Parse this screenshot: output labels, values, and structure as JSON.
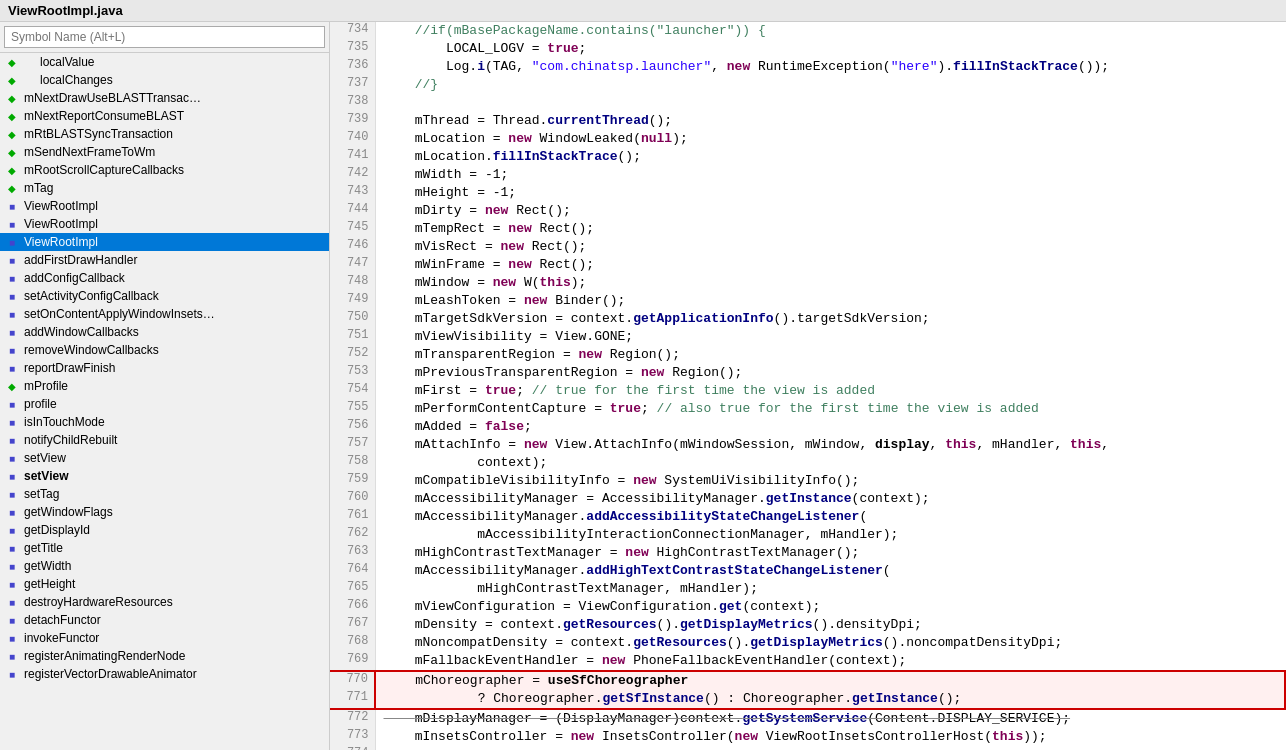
{
  "title": "ViewRootImpl.java",
  "search": {
    "placeholder": "Symbol Name (Alt+L)"
  },
  "sidebar": {
    "items": [
      {
        "icon": "green-diamond",
        "label": "localValue",
        "indent": 1
      },
      {
        "icon": "green-diamond",
        "label": "localChanges",
        "indent": 1
      },
      {
        "icon": "green-diamond",
        "label": "mNextDrawUseBLASTTransac…",
        "indent": 0
      },
      {
        "icon": "green-diamond",
        "label": "mNextReportConsumeBLAST",
        "indent": 0
      },
      {
        "icon": "green-diamond",
        "label": "mRtBLASTSyncTransaction",
        "indent": 0
      },
      {
        "icon": "green-diamond",
        "label": "mSendNextFrameToWm",
        "indent": 0
      },
      {
        "icon": "green-diamond",
        "label": "mRootScrollCaptureCallbacks",
        "indent": 0
      },
      {
        "icon": "green-diamond",
        "label": "mTag",
        "indent": 0
      },
      {
        "icon": "blue-square",
        "label": "ViewRootImpl",
        "indent": 0
      },
      {
        "icon": "blue-square",
        "label": "ViewRootImpl",
        "indent": 0
      },
      {
        "icon": "blue-square",
        "label": "ViewRootImpl",
        "indent": 0,
        "selected": true
      },
      {
        "icon": "blue-square",
        "label": "addFirstDrawHandler",
        "indent": 0
      },
      {
        "icon": "blue-square",
        "label": "addConfigCallback",
        "indent": 0
      },
      {
        "icon": "blue-square",
        "label": "setActivityConfigCallback",
        "indent": 0
      },
      {
        "icon": "blue-square",
        "label": "setOnContentApplyWindowInsets…",
        "indent": 0
      },
      {
        "icon": "blue-square",
        "label": "addWindowCallbacks",
        "indent": 0
      },
      {
        "icon": "blue-square",
        "label": "removeWindowCallbacks",
        "indent": 0
      },
      {
        "icon": "blue-square",
        "label": "reportDrawFinish",
        "indent": 0
      },
      {
        "icon": "green-diamond",
        "label": "mProfile",
        "indent": 0
      },
      {
        "icon": "blue-square",
        "label": "profile",
        "indent": 0
      },
      {
        "icon": "blue-square",
        "label": "isInTouchMode",
        "indent": 0
      },
      {
        "icon": "blue-square",
        "label": "notifyChildRebuilt",
        "indent": 0
      },
      {
        "icon": "blue-square",
        "label": "setView",
        "indent": 0
      },
      {
        "icon": "blue-square",
        "label": "setView",
        "indent": 0,
        "bold": true
      },
      {
        "icon": "blue-square",
        "label": "setTag",
        "indent": 0
      },
      {
        "icon": "blue-square",
        "label": "getWindowFlags",
        "indent": 0
      },
      {
        "icon": "blue-square",
        "label": "getDisplayId",
        "indent": 0
      },
      {
        "icon": "blue-square",
        "label": "getTitle",
        "indent": 0
      },
      {
        "icon": "blue-square",
        "label": "getWidth",
        "indent": 0
      },
      {
        "icon": "blue-square",
        "label": "getHeight",
        "indent": 0
      },
      {
        "icon": "blue-square",
        "label": "destroyHardwareResources",
        "indent": 0
      },
      {
        "icon": "blue-square",
        "label": "detachFunctor",
        "indent": 0
      },
      {
        "icon": "blue-square",
        "label": "invokeFunctor",
        "indent": 0
      },
      {
        "icon": "blue-square",
        "label": "registerAnimatingRenderNode",
        "indent": 0
      },
      {
        "icon": "blue-square",
        "label": "registerVectorDrawableAnimator",
        "indent": 0
      }
    ]
  },
  "code": {
    "lines": []
  }
}
